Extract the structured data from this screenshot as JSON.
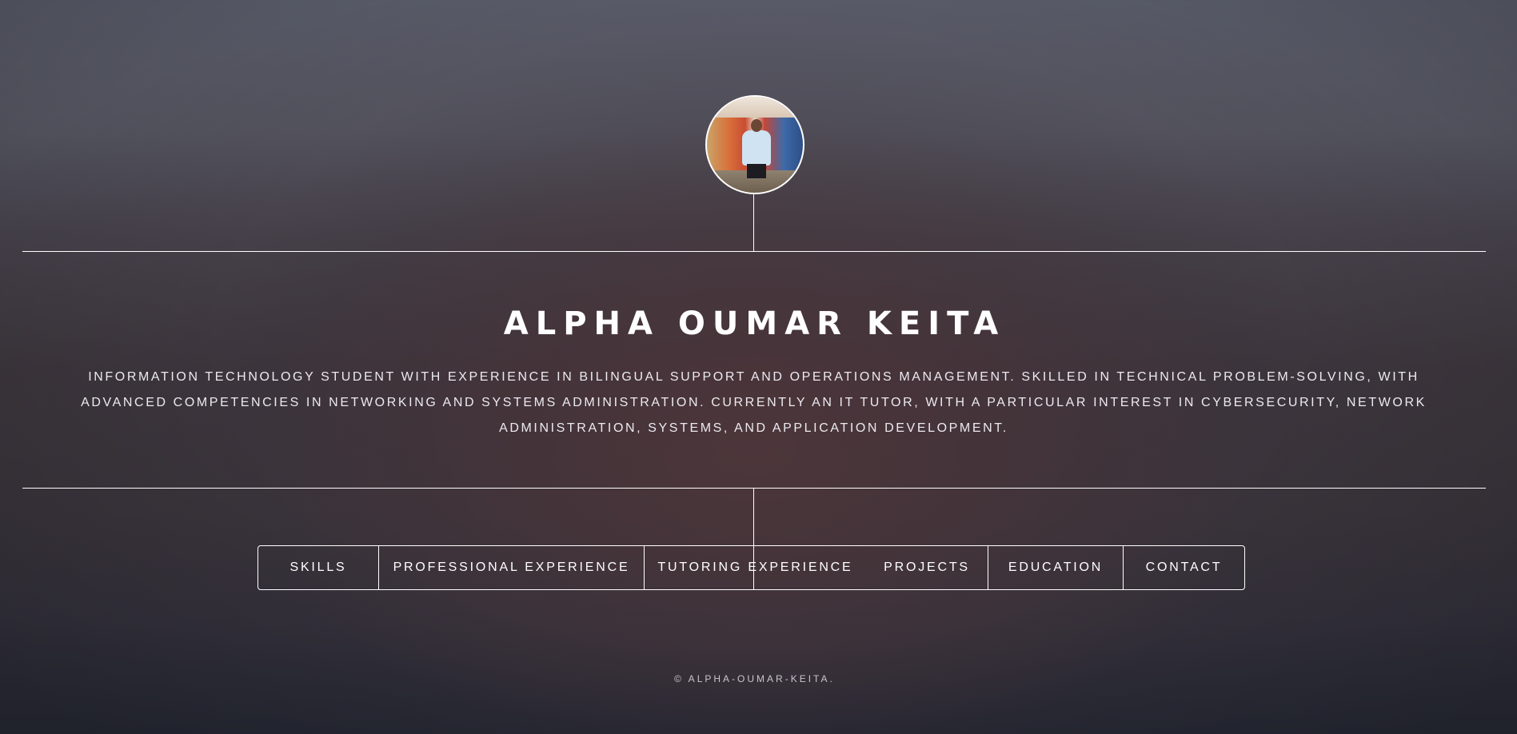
{
  "header": {
    "avatar_alt": "Alpha Oumar Keita portrait"
  },
  "main": {
    "title": "ALPHA OUMAR KEITA",
    "bio": "INFORMATION TECHNOLOGY STUDENT WITH EXPERIENCE IN BILINGUAL SUPPORT AND OPERATIONS MANAGEMENT. SKILLED IN TECHNICAL PROBLEM-SOLVING, WITH ADVANCED COMPETENCIES IN NETWORKING AND SYSTEMS ADMINISTRATION. CURRENTLY AN IT TUTOR, WITH A PARTICULAR INTEREST IN CYBERSECURITY, NETWORK ADMINISTRATION, SYSTEMS, AND APPLICATION DEVELOPMENT."
  },
  "nav": {
    "items": [
      {
        "label": "SKILLS"
      },
      {
        "label": "PROFESSIONAL EXPERIENCE"
      },
      {
        "label": "TUTORING EXPERIENCE"
      },
      {
        "label": "PROJECTS"
      },
      {
        "label": "EDUCATION"
      },
      {
        "label": "CONTACT"
      }
    ]
  },
  "footer": {
    "copyright": "© ALPHA-OUMAR-KEITA."
  },
  "colors": {
    "line": "#ffffff",
    "text": "#ffffff",
    "bg_top": "#5c5f6d",
    "bg_bottom": "#262935"
  }
}
